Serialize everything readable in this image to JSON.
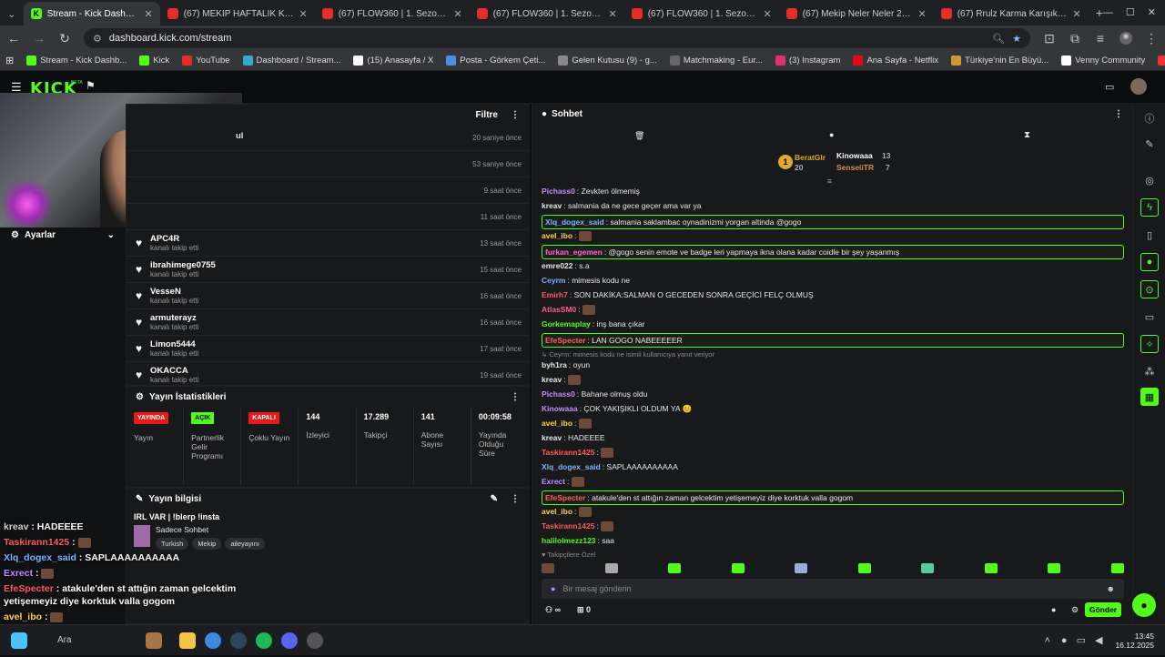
{
  "browser": {
    "tabs": [
      {
        "title": "Stream - Kick Dashboard",
        "active": true,
        "icon": "kick-icon"
      },
      {
        "title": "(67) MEKİP HAFTALIK KOMİK A",
        "icon": "youtube-icon"
      },
      {
        "title": "(67) FLOW360 | 1. Sezon 6. Böl",
        "icon": "youtube-icon"
      },
      {
        "title": "(67) FLOW360 | 1. Sezon 7. Böl",
        "icon": "youtube-icon"
      },
      {
        "title": "(67) FLOW360 | 1. Sezon 8. Böl",
        "icon": "youtube-icon"
      },
      {
        "title": "(67) Mekip Neler Neler 26.bölu",
        "icon": "youtube-icon"
      },
      {
        "title": "(67) Rrulz Karma Karışık #21 -",
        "icon": "youtube-icon"
      }
    ],
    "url": "dashboard.kick.com/stream",
    "bookmarks": [
      "Stream - Kick Dashb...",
      "Kick",
      "YouTube",
      "Dashboard / Stream...",
      "(15) Anasayfa / X",
      "Posta - Görkem Çeti...",
      "Gelen Kutusu (9) - g...",
      "Matchmaking - Eur...",
      "(3) Instagram",
      "Ana Sayfa - Netflix",
      "Türkiye'nin En Büyü...",
      "Venny Community",
      "Lifeinvader - VennyV"
    ]
  },
  "kick": {
    "logo": "KICK",
    "beta": "BETA"
  },
  "settings": {
    "label": "Ayarlar"
  },
  "events": {
    "filter": "Filtre",
    "first_partial": "ul",
    "items": [
      {
        "name": "",
        "action": "",
        "time": "20 saniye önce"
      },
      {
        "name": "",
        "action": "",
        "time": "53 saniye önce"
      },
      {
        "name": "",
        "action": "",
        "time": "9 saat önce"
      },
      {
        "name": "",
        "action": "",
        "time": "11 saat önce"
      },
      {
        "name": "APC4R",
        "action": "kanalı takip etti",
        "time": "13 saat önce"
      },
      {
        "name": "ibrahimege0755",
        "action": "kanalı takip etti",
        "time": "15 saat önce"
      },
      {
        "name": "VesseN",
        "action": "kanalı takip etti",
        "time": "16 saat önce"
      },
      {
        "name": "armuterayz",
        "action": "kanalı takip etti",
        "time": "16 saat önce"
      },
      {
        "name": "Limon5444",
        "action": "kanalı takip etti",
        "time": "17 saat önce"
      },
      {
        "name": "OKACCA",
        "action": "kanalı takip etti",
        "time": "19 saat önce"
      }
    ]
  },
  "stats": {
    "title": "Yayın İstatistikleri",
    "cols": [
      {
        "badge": "YAYINDA",
        "badge_color": "#e91916",
        "label": "Yayın"
      },
      {
        "badge": "AÇIK",
        "badge_color": "#53fc18",
        "label": "Partnerlik Gelir Programı"
      },
      {
        "badge": "KAPALI",
        "badge_color": "#e91916",
        "label": "Çoklu Yayın"
      },
      {
        "value": "144",
        "label": "İzleyici"
      },
      {
        "value": "17.289",
        "label": "Takipçi"
      },
      {
        "value": "141",
        "label": "Abone Sayısı"
      },
      {
        "value": "00:09:58",
        "label": "Yayında Olduğu Süre"
      }
    ]
  },
  "info": {
    "title": "Yayın bilgisi",
    "stream_title": "IRL VAR | !blerp !insta",
    "category": "Sadece Sohbet",
    "tags": [
      "Turkish",
      "Mekip",
      "aileyayını"
    ]
  },
  "chat": {
    "title": "Sohbet",
    "leaders": {
      "first": "BeratGlr",
      "first_count": "20",
      "second": "Kinowaaa",
      "second_count": "13",
      "third": "SenseiiTR",
      "third_count": "7"
    },
    "reply_note": "↳ Ceyrm: mimesis kodu ne isimli kullanıcıya yanıt veriyor",
    "followers_only": "Takipçilere Özel",
    "messages": [
      {
        "user": "Pichass0",
        "color": "#c58cff",
        "text": "Zevkten ölmemiş"
      },
      {
        "user": "kreav",
        "color": "#e6e6e6",
        "text": "salmania da ne gece geçer ama var ya"
      },
      {
        "user": "Xlq_dogex_said",
        "color": "#7fb3ff",
        "text": "salmania saklambac oynadinizmi yorgan altinda @gogo",
        "hl": true
      },
      {
        "user": "avel_ibo",
        "color": "#ffd34d",
        "text": "",
        "emote": true
      },
      {
        "user": "furkan_egemen",
        "color": "#ff66cc",
        "text": "@gogo senin emote ve badge leri yapmaya ikna olana kadar coidle bir şey yaşanmış",
        "hl": true
      },
      {
        "user": "emre022",
        "color": "#e6e6e6",
        "text": "s.a"
      },
      {
        "user": "Ceyrm",
        "color": "#7fb3ff",
        "text": "mimesis kodu ne"
      },
      {
        "user": "Emirh7",
        "color": "#ff5b5b",
        "text": "SON DAKİKA:SALMAN O GECEDEN SONRA GEÇİCİ FELÇ OLMUŞ"
      },
      {
        "user": "AtlasSM0",
        "color": "#ff5b8a",
        "text": "",
        "emote": true
      },
      {
        "user": "Gorkemaplay",
        "color": "#53fc18",
        "text": "inş bana çıkar"
      },
      {
        "user": "EfeSpecter",
        "color": "#ff5b5b",
        "text": "LAN GOGO NABEEEEER",
        "hl": true
      },
      {
        "user": "byh1ra",
        "color": "#e6e6e6",
        "text": "oyun"
      },
      {
        "user": "kreav",
        "color": "#e6e6e6",
        "text": "",
        "emote": true
      },
      {
        "user": "Pichass0",
        "color": "#c58cff",
        "text": "Bahane olmuş oldu"
      },
      {
        "user": "Kinowaaa",
        "color": "#c58cff",
        "text": "ÇOK YAKIŞIKLI OLDUM YA 😊"
      },
      {
        "user": "avel_ibo",
        "color": "#ffd34d",
        "text": "",
        "emote": true
      },
      {
        "user": "kreav",
        "color": "#e6e6e6",
        "text": "HADEEEE"
      },
      {
        "user": "Taskirann1425",
        "color": "#ff5b5b",
        "text": "",
        "emote": true
      },
      {
        "user": "Xlq_dogex_said",
        "color": "#7fb3ff",
        "text": "SAPLAAAAAAAAAA"
      },
      {
        "user": "Exrect",
        "color": "#c58cff",
        "text": "",
        "emote": true
      },
      {
        "user": "EfeSpecter",
        "color": "#ff5b5b",
        "text": "atakule'den st attığın zaman gelcektim yetişemeyiz diye korktuk valla gogom",
        "hl": true
      },
      {
        "user": "avel_ibo",
        "color": "#ffd34d",
        "text": "",
        "emote": true
      },
      {
        "user": "Taskirann1425",
        "color": "#ff5b5b",
        "text": "",
        "emote": true
      },
      {
        "user": "halilolmezz123",
        "color": "#53fc18",
        "text": "saa"
      }
    ],
    "input_placeholder": "Bir mesaj gönderin",
    "send": "Gönder",
    "points": "∞",
    "gifts": "0"
  },
  "overlay": [
    {
      "user": "kreav",
      "color": "#cfcfcf",
      "text": "HADEEEE"
    },
    {
      "user": "Taskirann1425",
      "color": "#ff5b5b",
      "text": ""
    },
    {
      "user": "Xlq_dogex_said",
      "color": "#7fb3ff",
      "text": "SAPLAAAAAAAAAA"
    },
    {
      "user": "Exrect",
      "color": "#c58cff",
      "text": ""
    },
    {
      "user": "EfeSpecter",
      "color": "#ff5b5b",
      "text": "atakule'den st attığın zaman gelcektim yetişemeyiz diye korktuk valla gogom"
    },
    {
      "user": "avel_ibo",
      "color": "#ffd34d",
      "text": ""
    },
    {
      "user": "Taskirann1425",
      "color": "#ff5b5b",
      "text": ""
    },
    {
      "user": "halilolmezz123",
      "color": "#53fc18",
      "text": "saa"
    }
  ],
  "taskbar": {
    "search": "Ara",
    "time": "13:45",
    "date": "16.12.2025"
  }
}
